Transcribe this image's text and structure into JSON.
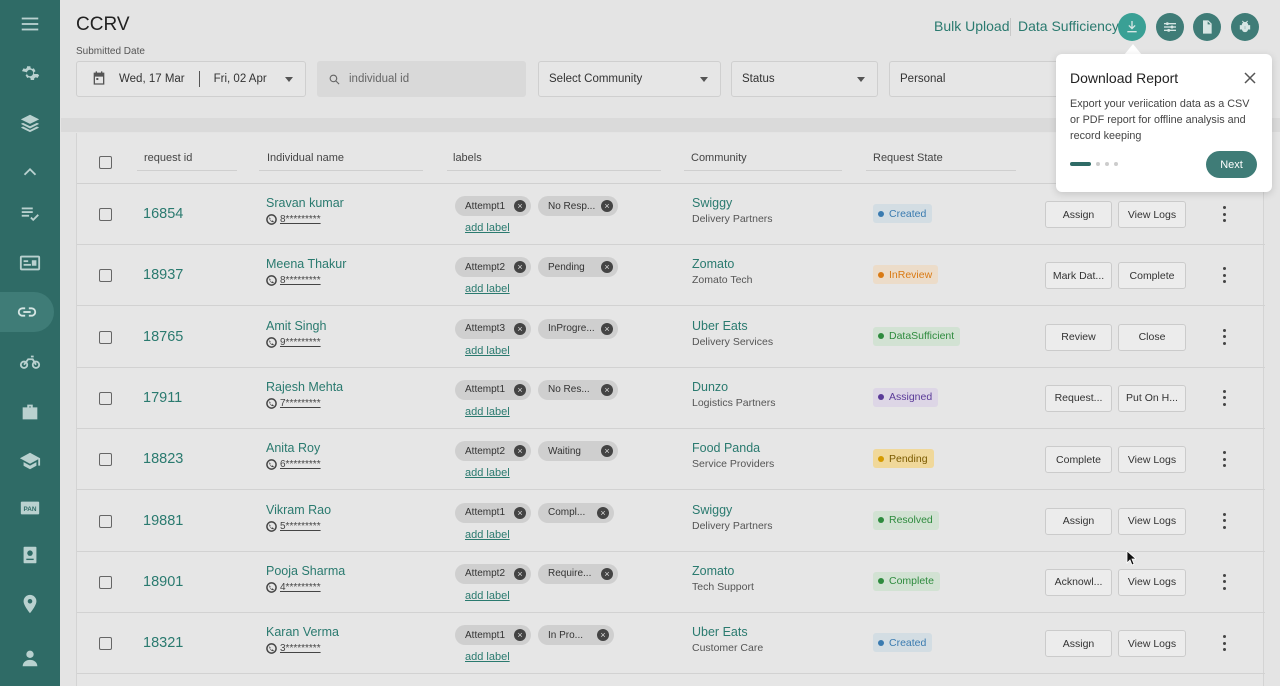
{
  "app": {
    "title": "CCRV"
  },
  "top_links": {
    "bulk_upload": "Bulk Upload",
    "data_sufficiency": "Data Sufficiency"
  },
  "filters": {
    "submitted_label": "Submitted Date",
    "date_from": "Wed, 17 Mar",
    "date_to": "Fri, 02 Apr",
    "search_placeholder": "individual id",
    "community": "Select Community",
    "status": "Status",
    "personal": "Personal"
  },
  "table": {
    "headers": {
      "request_id": "request id",
      "name": "Individual name",
      "labels": "labels",
      "community": "Community",
      "state": "Request State"
    },
    "add_label": "add label",
    "rows": [
      {
        "id": "16854",
        "name": "Sravan kumar",
        "phone": "8*********",
        "label1": "Attempt1",
        "label2": "No Resp...",
        "community": "Swiggy",
        "community_sub": "Delivery Partners",
        "state": "Created",
        "action1": "Assign",
        "action2": "View Logs"
      },
      {
        "id": "18937",
        "name": "Meena Thakur",
        "phone": "8*********",
        "label1": "Attempt2",
        "label2": "Pending",
        "community": "Zomato",
        "community_sub": "Zomato Tech",
        "state": "InReview",
        "action1": "Mark Dat...",
        "action2": "Complete"
      },
      {
        "id": "18765",
        "name": "Amit Singh",
        "phone": "9*********",
        "label1": "Attempt3",
        "label2": "InProgre...",
        "community": "Uber Eats",
        "community_sub": "Delivery Services",
        "state": "DataSufficient",
        "action1": "Review",
        "action2": "Close"
      },
      {
        "id": "17911",
        "name": "Rajesh Mehta",
        "phone": "7*********",
        "label1": "Attempt1",
        "label2": "No Res...",
        "community": "Dunzo",
        "community_sub": "Logistics Partners",
        "state": "Assigned",
        "action1": "Request...",
        "action2": "Put On H..."
      },
      {
        "id": "18823",
        "name": "Anita Roy",
        "phone": "6*********",
        "label1": "Attempt2",
        "label2": "Waiting",
        "community": "Food Panda",
        "community_sub": "Service Providers",
        "state": "Pending",
        "action1": "Complete",
        "action2": "View Logs"
      },
      {
        "id": "19881",
        "name": "Vikram Rao",
        "phone": "5*********",
        "label1": "Attempt1",
        "label2": "Compl...",
        "community": "Swiggy",
        "community_sub": "Delivery Partners",
        "state": "Resolved",
        "action1": "Assign",
        "action2": "View Logs"
      },
      {
        "id": "18901",
        "name": "Pooja Sharma",
        "phone": "4*********",
        "label1": "Attempt2",
        "label2": "Require...",
        "community": "Zomato",
        "community_sub": "Tech Support",
        "state": "Complete",
        "action1": "Acknowl...",
        "action2": "View Logs"
      },
      {
        "id": "18321",
        "name": "Karan Verma",
        "phone": "3*********",
        "label1": "Attempt1",
        "label2": "In Pro...",
        "community": "Uber Eats",
        "community_sub": "Customer Care",
        "state": "Created",
        "action1": "Assign",
        "action2": "View Logs"
      }
    ]
  },
  "status_colors": {
    "Created": {
      "bg": "#d3dde3",
      "fg": "#3a7bb0",
      "dot": "#3a7bb0"
    },
    "InReview": {
      "bg": "#ecdcc9",
      "fg": "#d97a14",
      "dot": "#d97a14"
    },
    "DataSufficient": {
      "bg": "#d2e2d3",
      "fg": "#2e8b3e",
      "dot": "#2e8b3e"
    },
    "Assigned": {
      "bg": "#ddd6e6",
      "fg": "#5a3a98",
      "dot": "#5a3a98"
    },
    "Pending": {
      "bg": "#f0d89a",
      "fg": "#7a5a00",
      "dot": "#d49a00"
    },
    "Resolved": {
      "bg": "#d2e2d3",
      "fg": "#2e8b3e",
      "dot": "#2e8b3e"
    },
    "Complete": {
      "bg": "#d2e2d3",
      "fg": "#2e8b3e",
      "dot": "#2e8b3e"
    }
  },
  "popover": {
    "title": "Download Report",
    "body": "Export your veriication data as a CSV or PDF report for offline analysis and record keeping",
    "next": "Next"
  }
}
